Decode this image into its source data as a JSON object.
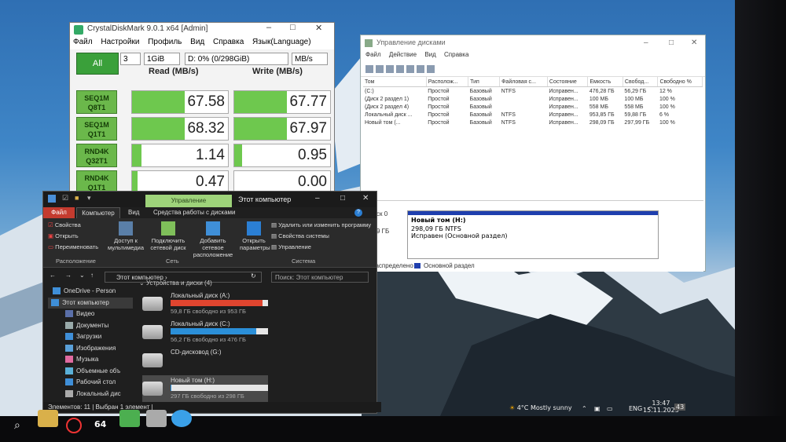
{
  "cdm": {
    "title": "CrystalDiskMark 9.0.1 x64 [Admin]",
    "menu": [
      "Файл",
      "Настройки",
      "Профиль",
      "Вид",
      "Справка",
      "Язык(Language)"
    ],
    "all_label": "All",
    "count": "3",
    "size": "1GiB",
    "drive": "D: 0% (0/298GiB)",
    "unit": "MB/s",
    "read_header": "Read (MB/s)",
    "write_header": "Write (MB/s)",
    "rows": [
      {
        "l1": "SEQ1M",
        "l2": "Q8T1",
        "read": "67.58",
        "write": "67.77",
        "rf": 0.55,
        "wf": 0.55
      },
      {
        "l1": "SEQ1M",
        "l2": "Q1T1",
        "read": "68.32",
        "write": "67.97",
        "rf": 0.55,
        "wf": 0.55
      },
      {
        "l1": "RND4K",
        "l2": "Q32T1",
        "read": "1.14",
        "write": "0.95",
        "rf": 0.1,
        "wf": 0.08
      },
      {
        "l1": "RND4K",
        "l2": "Q1T1",
        "read": "0.47",
        "write": "0.00",
        "rf": 0.06,
        "wf": 0.0
      }
    ]
  },
  "dm": {
    "title": "Управление дисками",
    "menu": [
      "Файл",
      "Действие",
      "Вид",
      "Справка"
    ],
    "headers": [
      "Том",
      "Располож...",
      "Тип",
      "Файловая с...",
      "Состояние",
      "Емкость",
      "Свобод...",
      "Свободно %"
    ],
    "rows": [
      [
        "(C:)",
        "Простой",
        "Базовый",
        "NTFS",
        "Исправен...",
        "476,28 ГБ",
        "56,29 ГБ",
        "12 %"
      ],
      [
        "(Диск 2 раздел 1)",
        "Простой",
        "Базовый",
        "",
        "Исправен...",
        "100 МБ",
        "100 МБ",
        "100 %"
      ],
      [
        "(Диск 2 раздел 4)",
        "Простой",
        "Базовый",
        "",
        "Исправен...",
        "558 МБ",
        "558 МБ",
        "100 %"
      ],
      [
        "Локальный диск ...",
        "Простой",
        "Базовый",
        "NTFS",
        "Исправен...",
        "953,85 ГБ",
        "59,88 ГБ",
        "6 %"
      ],
      [
        "Новый том (...",
        "Простой",
        "Базовый",
        "NTFS",
        "Исправен...",
        "298,09 ГБ",
        "297,99 ГБ",
        "100 %"
      ]
    ],
    "disk_label": "ск 0",
    "disk_size": "9 ГБ",
    "volume_name": "Новый том (H:)",
    "volume_size": "298,09 ГБ NTFS",
    "volume_status": "Исправен (Основной раздел)",
    "legend_left": "распределено",
    "legend_right": "Основной раздел"
  },
  "explorer": {
    "context_tab": "Управление",
    "title": "Этот компьютер",
    "tabs": {
      "file": "Файл",
      "computer": "Компьютер",
      "view": "Вид",
      "drive": "Средства работы с дисками"
    },
    "ribbon": {
      "props": "Свойства",
      "open": "Открыть",
      "rename": "Переименовать",
      "media": "Доступ к мультимедиа",
      "map": "Подключить сетевой диск",
      "add": "Добавить сетевое расположение",
      "params": "Открыть параметры",
      "uninstall": "Удалить или изменить программу",
      "sysprops": "Свойства системы",
      "manage": "Управление",
      "g1": "Расположение",
      "g2": "Сеть",
      "g3": "Система"
    },
    "address": "Этот компьютер",
    "search_placeholder": "Поиск: Этот компьютер",
    "nav": [
      "OneDrive - Person",
      "Этот компьютер",
      "Видео",
      "Документы",
      "Загрузки",
      "Изображения",
      "Музыка",
      "Объемные объ",
      "Рабочий стол",
      "Локальный дис"
    ],
    "section": "Устройства и диски (4)",
    "drives": [
      {
        "name": "Локальный диск (A:)",
        "free": "59,8 ГБ свободно из 953 ГБ",
        "used": 0.94,
        "color": "#e0452f"
      },
      {
        "name": "Локальный диск (C:)",
        "free": "56,2 ГБ свободно из 476 ГБ",
        "used": 0.88,
        "color": "#2b8fd8"
      },
      {
        "name": "CD-дисковод (G:)",
        "free": "",
        "used": 0,
        "color": "#2b8fd8"
      },
      {
        "name": "Новый том (H:)",
        "free": "297 ГБ свободно из 298 ГБ",
        "used": 0.01,
        "color": "#2b8fd8"
      }
    ],
    "status": "Элементов: 11   |   Выбран 1 элемент  |"
  },
  "taskbar": {
    "weather": "4°C  Mostly sunny",
    "lang": "ENG",
    "time": "13:47",
    "date": "15.11.2025",
    "notif": "43",
    "badge": "64"
  }
}
